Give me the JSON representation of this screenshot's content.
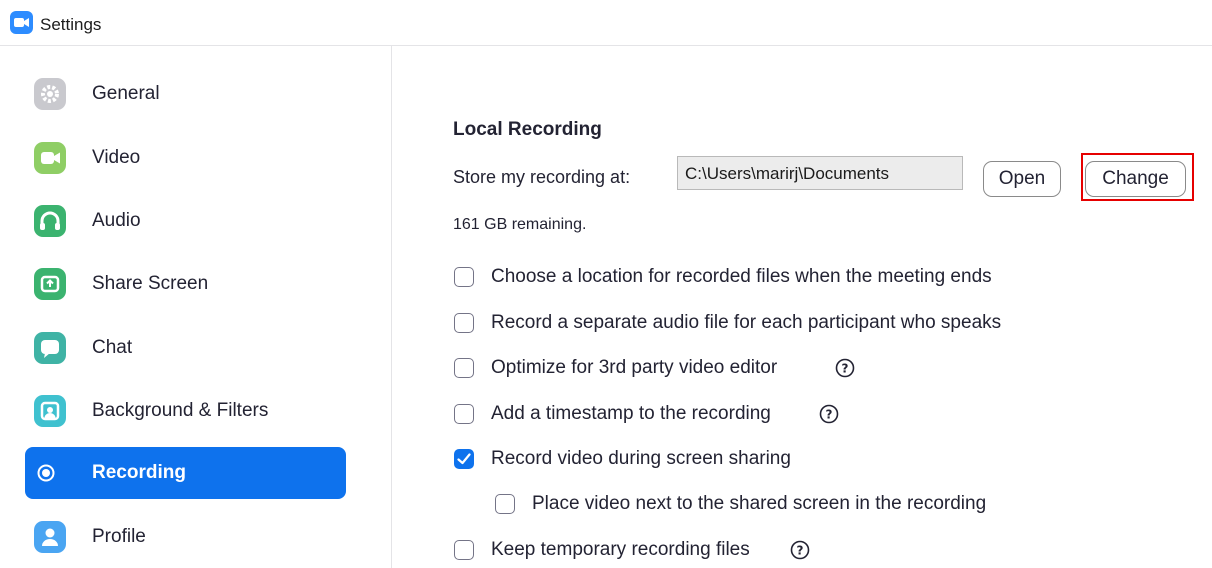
{
  "window": {
    "title": "Settings"
  },
  "sidebar": {
    "items": [
      {
        "label": "General",
        "icon": "gear-icon",
        "color": "#c9c9ce",
        "active": false
      },
      {
        "label": "Video",
        "icon": "video-camera-icon",
        "color": "#8fce65",
        "active": false
      },
      {
        "label": "Audio",
        "icon": "headphones-icon",
        "color": "#3bb36f",
        "active": false
      },
      {
        "label": "Share Screen",
        "icon": "share-screen-icon",
        "color": "#3bb36f",
        "active": false
      },
      {
        "label": "Chat",
        "icon": "chat-bubble-icon",
        "color": "#3fb3a5",
        "active": false
      },
      {
        "label": "Background & Filters",
        "icon": "background-icon",
        "color": "#3fc1cf",
        "active": false
      },
      {
        "label": "Recording",
        "icon": "record-icon",
        "color": "#ffffff",
        "active": true
      },
      {
        "label": "Profile",
        "icon": "person-icon",
        "color": "#4aa5f2",
        "active": false
      }
    ]
  },
  "main": {
    "section_title": "Local Recording",
    "store_label": "Store my recording at:",
    "path_value": "C:\\Users\\marirj\\Documents",
    "open_label": "Open",
    "change_label": "Change",
    "remaining": "161 GB remaining.",
    "options": [
      {
        "label": "Choose a location for recorded files when the meeting ends",
        "checked": false,
        "help": false
      },
      {
        "label": "Record a separate audio file for each participant who speaks",
        "checked": false,
        "help": false
      },
      {
        "label": "Optimize for 3rd party video editor",
        "checked": false,
        "help": true
      },
      {
        "label": "Add a timestamp to the recording",
        "checked": false,
        "help": true
      },
      {
        "label": "Record video during screen sharing",
        "checked": true,
        "help": false
      },
      {
        "label": "Place video next to the shared screen in the recording",
        "checked": false,
        "help": false
      },
      {
        "label": "Keep temporary recording files",
        "checked": false,
        "help": true
      }
    ]
  },
  "colors": {
    "accent": "#0e72ed",
    "highlight": "#e60000",
    "brand": "#2d8cff"
  }
}
